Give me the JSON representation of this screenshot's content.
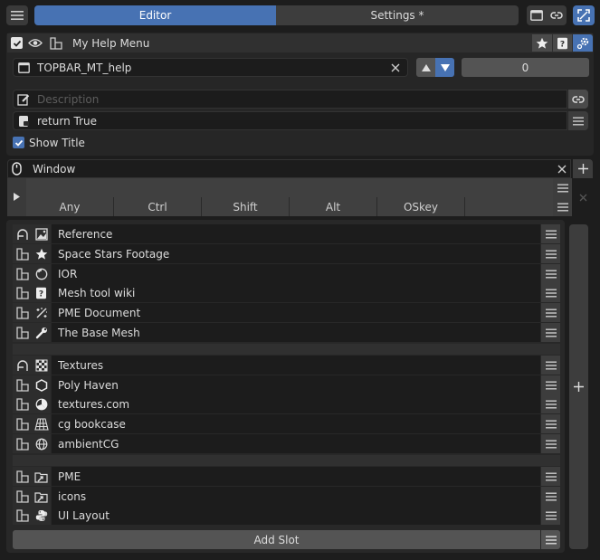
{
  "header": {
    "tab_editor": "Editor",
    "tab_settings": "Settings *"
  },
  "item": {
    "name": "My Help Menu",
    "id": "TOPBAR_MT_help",
    "counter": "0",
    "description_placeholder": "Description",
    "poll": "return True",
    "show_title_label": "Show Title",
    "show_title_checked": true
  },
  "hotkey": {
    "context": "Window",
    "modifiers": [
      "Any",
      "Ctrl",
      "Shift",
      "Alt",
      "OSkey"
    ]
  },
  "slots": {
    "groups": [
      {
        "items": [
          {
            "label": "Reference",
            "icon": "image-icon",
            "first": true
          },
          {
            "label": "Space Stars Footage",
            "icon": "star-icon"
          },
          {
            "label": "IOR",
            "icon": "material-icon"
          },
          {
            "label": "Mesh tool wiki",
            "icon": "help-icon"
          },
          {
            "label": "PME Document",
            "icon": "sparkle-icon"
          },
          {
            "label": "The Base Mesh",
            "icon": "wrench-icon"
          }
        ]
      },
      {
        "items": [
          {
            "label": "Textures",
            "icon": "checker-icon",
            "first": true
          },
          {
            "label": "Poly Haven",
            "icon": "hexagon-icon"
          },
          {
            "label": "textures.com",
            "icon": "pie-icon"
          },
          {
            "label": "cg bookcase",
            "icon": "grid-perspective-icon"
          },
          {
            "label": "ambientCG",
            "icon": "globe-icon"
          }
        ]
      },
      {
        "items": [
          {
            "label": "PME",
            "icon": "folder-link-icon"
          },
          {
            "label": "icons",
            "icon": "folder-link-icon"
          },
          {
            "label": "UI Layout",
            "icon": "python-icon"
          }
        ]
      }
    ],
    "add_slot_label": "Add Slot"
  },
  "colors": {
    "accent": "#4772b3",
    "bg": "#1d1d1d",
    "panel": "#2b2b2b",
    "field": "#1c1c1c"
  }
}
